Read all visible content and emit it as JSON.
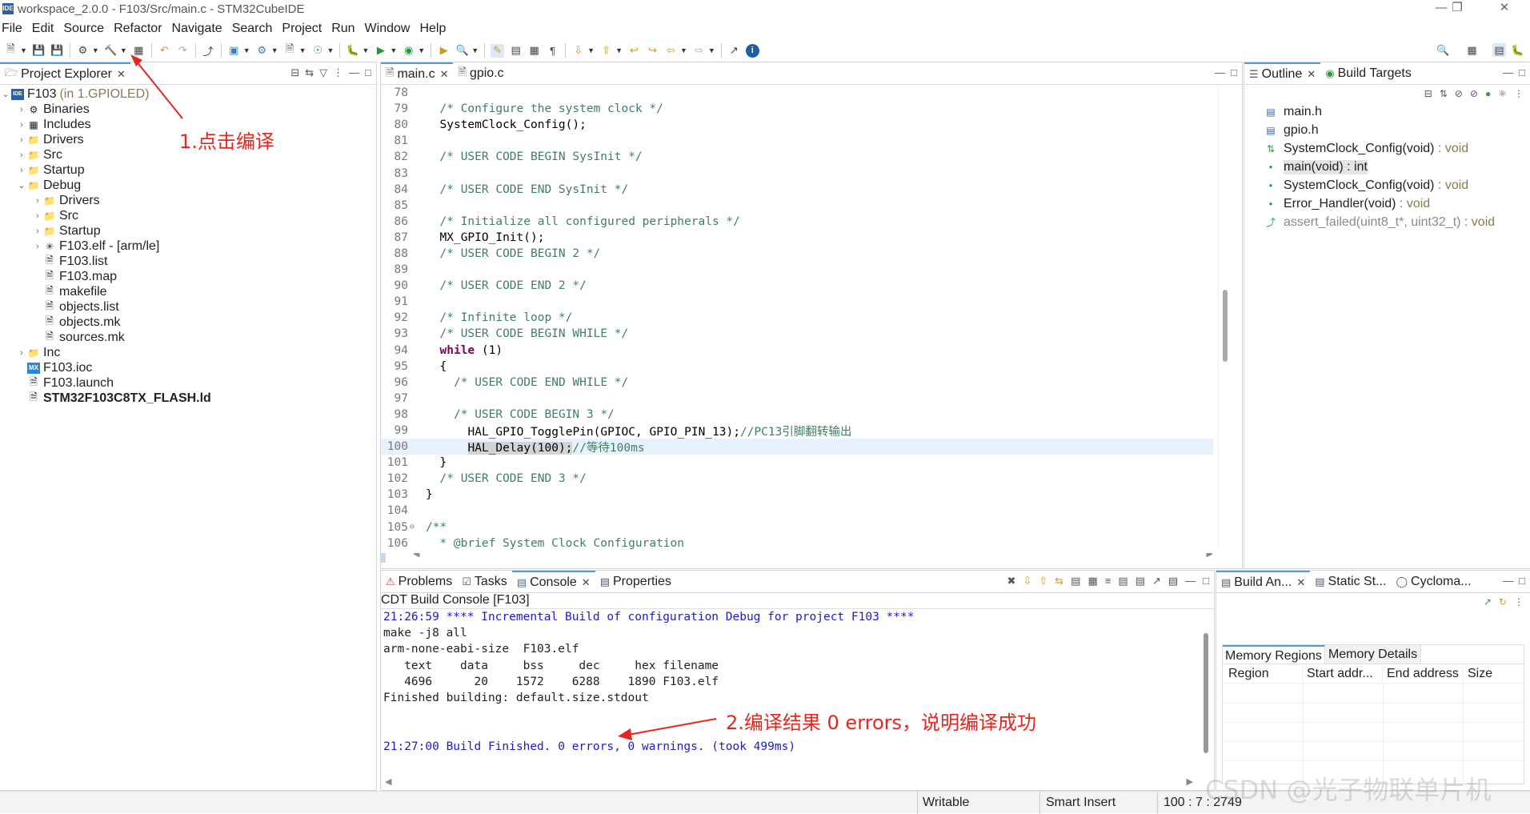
{
  "window": {
    "title": "workspace_2.0.0 - F103/Src/main.c - STM32CubeIDE",
    "app_icon_text": "IDE"
  },
  "menu": [
    "File",
    "Edit",
    "Source",
    "Refactor",
    "Navigate",
    "Search",
    "Project",
    "Run",
    "Window",
    "Help"
  ],
  "project_explorer": {
    "tab_label": "Project Explorer",
    "root": {
      "name": "F103",
      "suffix": "(in 1.GPIOLED)"
    },
    "items": [
      {
        "label": "Binaries",
        "level": 1,
        "expand": "collapsed",
        "icon": "binaries-icon"
      },
      {
        "label": "Includes",
        "level": 1,
        "expand": "collapsed",
        "icon": "includes-icon"
      },
      {
        "label": "Drivers",
        "level": 1,
        "expand": "collapsed",
        "icon": "folder-icon"
      },
      {
        "label": "Src",
        "level": 1,
        "expand": "collapsed",
        "icon": "folder-icon"
      },
      {
        "label": "Startup",
        "level": 1,
        "expand": "collapsed",
        "icon": "folder-icon"
      },
      {
        "label": "Debug",
        "level": 1,
        "expand": "expanded",
        "icon": "folder-icon"
      },
      {
        "label": "Drivers",
        "level": 2,
        "expand": "collapsed",
        "icon": "folder-icon"
      },
      {
        "label": "Src",
        "level": 2,
        "expand": "collapsed",
        "icon": "folder-icon"
      },
      {
        "label": "Startup",
        "level": 2,
        "expand": "collapsed",
        "icon": "folder-icon"
      },
      {
        "label": "F103.elf - [arm/le]",
        "level": 2,
        "expand": "collapsed",
        "icon": "elf-icon"
      },
      {
        "label": "F103.list",
        "level": 2,
        "expand": "none",
        "icon": "file-icon"
      },
      {
        "label": "F103.map",
        "level": 2,
        "expand": "none",
        "icon": "file-icon"
      },
      {
        "label": "makefile",
        "level": 2,
        "expand": "none",
        "icon": "file-icon"
      },
      {
        "label": "objects.list",
        "level": 2,
        "expand": "none",
        "icon": "file-icon"
      },
      {
        "label": "objects.mk",
        "level": 2,
        "expand": "none",
        "icon": "file-icon"
      },
      {
        "label": "sources.mk",
        "level": 2,
        "expand": "none",
        "icon": "file-icon"
      },
      {
        "label": "Inc",
        "level": 1,
        "expand": "collapsed",
        "icon": "folder-icon"
      },
      {
        "label": "F103.ioc",
        "level": 1,
        "expand": "none",
        "icon": "mx-icon"
      },
      {
        "label": "F103.launch",
        "level": 1,
        "expand": "none",
        "icon": "file-icon"
      },
      {
        "label": "STM32F103C8TX_FLASH.ld",
        "level": 1,
        "expand": "none",
        "icon": "file-icon",
        "bold": true
      }
    ]
  },
  "editor": {
    "tabs": [
      {
        "label": "main.c",
        "active": true
      },
      {
        "label": "gpio.c",
        "active": false
      }
    ],
    "lines": [
      {
        "n": "78",
        "text": ""
      },
      {
        "n": "79",
        "text": "/* Configure the system clock */",
        "kind": "comment",
        "indent": 2
      },
      {
        "n": "80",
        "text": "SystemClock_Config();",
        "indent": 2
      },
      {
        "n": "81",
        "text": ""
      },
      {
        "n": "82",
        "text": "/* USER CODE BEGIN SysInit */",
        "kind": "comment",
        "indent": 2
      },
      {
        "n": "83",
        "text": ""
      },
      {
        "n": "84",
        "text": "/* USER CODE END SysInit */",
        "kind": "comment",
        "indent": 2
      },
      {
        "n": "85",
        "text": ""
      },
      {
        "n": "86",
        "text": "/* Initialize all configured peripherals */",
        "kind": "comment",
        "indent": 2
      },
      {
        "n": "87",
        "text": "MX_GPIO_Init();",
        "indent": 2
      },
      {
        "n": "88",
        "text": "/* USER CODE BEGIN 2 */",
        "kind": "comment",
        "indent": 2
      },
      {
        "n": "89",
        "text": ""
      },
      {
        "n": "90",
        "text": "/* USER CODE END 2 */",
        "kind": "comment",
        "indent": 2
      },
      {
        "n": "91",
        "text": ""
      },
      {
        "n": "92",
        "text": "/* Infinite loop */",
        "kind": "comment",
        "indent": 2
      },
      {
        "n": "93",
        "text": "/* USER CODE BEGIN WHILE */",
        "kind": "comment",
        "indent": 2
      },
      {
        "n": "94",
        "text": "while",
        "rest": " (1)",
        "kind": "keyword",
        "indent": 2
      },
      {
        "n": "95",
        "text": "{",
        "indent": 2
      },
      {
        "n": "96",
        "text": "/* USER CODE END WHILE */",
        "kind": "comment",
        "indent": 4
      },
      {
        "n": "97",
        "text": ""
      },
      {
        "n": "98",
        "text": "/* USER CODE BEGIN 3 */",
        "kind": "comment",
        "indent": 4
      },
      {
        "n": "99",
        "text": "HAL_GPIO_TogglePin(GPIOC, GPIO_PIN_13);",
        "trail": "//PC13引脚翻转输出",
        "indent": 6
      },
      {
        "n": "100",
        "text": "HAL_Delay(100);",
        "trail": "//等待100ms",
        "indent": 6,
        "highlight": true
      },
      {
        "n": "101",
        "text": "}",
        "indent": 2
      },
      {
        "n": "102",
        "text": "/* USER CODE END 3 */",
        "kind": "comment",
        "indent": 2
      },
      {
        "n": "103",
        "text": "}",
        "indent": 0
      },
      {
        "n": "104",
        "text": ""
      },
      {
        "n": "105",
        "text": "/**",
        "kind": "comment",
        "indent": 0,
        "fold": true
      },
      {
        "n": "106",
        "text": "  * @brief System Clock Configuration",
        "kind": "comment",
        "indent": 0
      }
    ]
  },
  "outline": {
    "tabs": [
      "Outline",
      "Build Targets"
    ],
    "items": [
      {
        "label": "main.h",
        "type": "",
        "icon": "include-icon"
      },
      {
        "label": "gpio.h",
        "type": "",
        "icon": "include-icon"
      },
      {
        "label": "SystemClock_Config(void)",
        "type": " : void",
        "icon": "declaration-icon"
      },
      {
        "label": "main(void) : int",
        "type": "",
        "icon": "function-icon",
        "selected": true
      },
      {
        "label": "SystemClock_Config(void)",
        "type": " : void",
        "icon": "function-icon"
      },
      {
        "label": "Error_Handler(void)",
        "type": " : void",
        "icon": "function-icon"
      },
      {
        "label": "assert_failed(uint8_t*, uint32_t)",
        "type": " : void",
        "icon": "macro-icon",
        "dim": true
      }
    ]
  },
  "console": {
    "tabs": [
      "Problems",
      "Tasks",
      "Console",
      "Properties"
    ],
    "title": "CDT Build Console [F103]",
    "lines": [
      {
        "text": "21:26:59 **** Incremental Build of configuration Debug for project F103 ****",
        "color": "blue"
      },
      {
        "text": "make -j8 all"
      },
      {
        "text": "arm-none-eabi-size  F103.elf"
      },
      {
        "text": "   text    data     bss     dec     hex filename"
      },
      {
        "text": "   4696      20    1572    6288    1890 F103.elf"
      },
      {
        "text": "Finished building: default.size.stdout"
      },
      {
        "text": ""
      },
      {
        "text": ""
      },
      {
        "text": "21:27:00 Build Finished. 0 errors, 0 warnings. (took 499ms)",
        "color": "blue"
      }
    ]
  },
  "build_analyzer": {
    "tabs": [
      "Build An...",
      "Static St...",
      "Cycloma..."
    ],
    "subtabs": [
      "Memory Regions",
      "Memory Details"
    ],
    "columns": [
      "Region",
      "Start addr...",
      "End address",
      "Size"
    ]
  },
  "annotations": {
    "a1": "1.点击编译",
    "a2": "2.编译结果 0 errors，说明编译成功"
  },
  "status": {
    "writable": "Writable",
    "insert": "Smart Insert",
    "position": "100 : 7 : 2749"
  },
  "watermark": "CSDN @光子物联单片机"
}
